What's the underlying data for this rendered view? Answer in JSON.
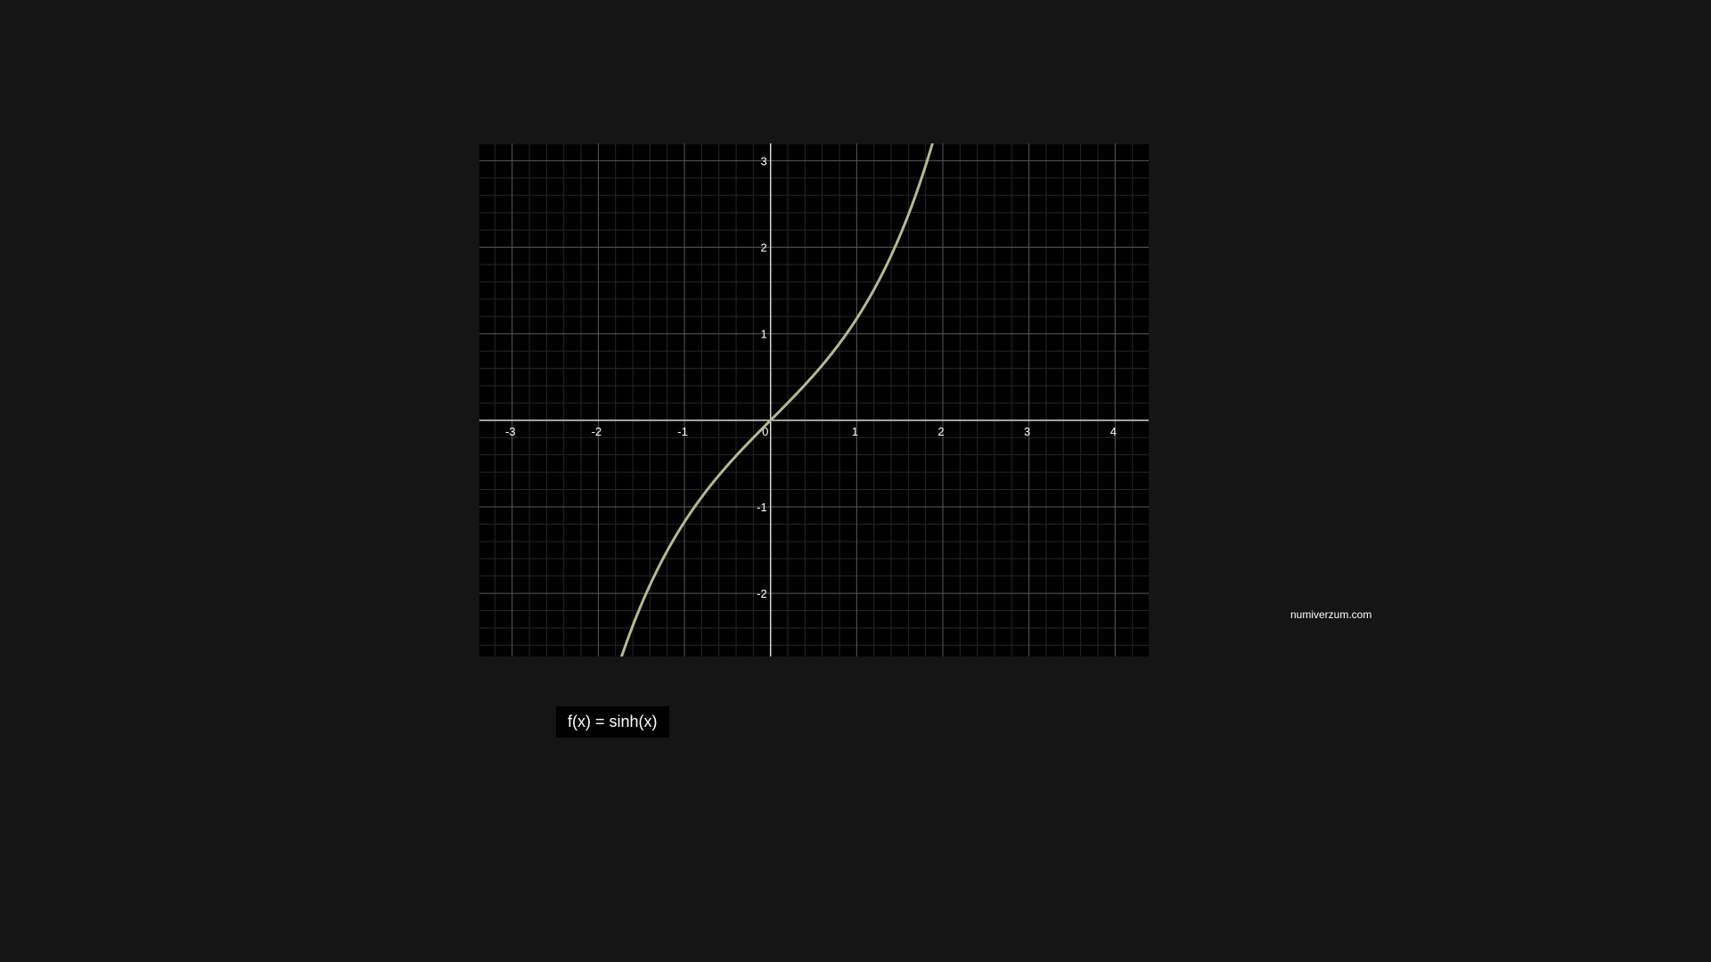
{
  "watermark": "numiverzum.com",
  "function_label": "f(x) = sinh(x)",
  "colors": {
    "page_background": "#151515",
    "plot_background": "#000000",
    "curve": "#b8b98a",
    "axis": "#d8d8d8",
    "major_grid": "#5a5a5a",
    "minor_grid": "#262626",
    "text": "#ffffff"
  },
  "chart_data": {
    "type": "line",
    "function": "sinh",
    "xlim": [
      -3.38,
      4.39
    ],
    "ylim": [
      -2.73,
      3.2
    ],
    "x_ticks": [
      -3,
      -2,
      -1,
      0,
      1,
      2,
      3,
      4
    ],
    "x_tick_labels": [
      "-3",
      "-2",
      "-1",
      "0",
      "1",
      "2",
      "3",
      "4"
    ],
    "y_ticks": [
      -2,
      -1,
      1,
      2,
      3
    ],
    "y_tick_labels": [
      "-2",
      "-1",
      "1",
      "2",
      "3"
    ],
    "minor_divisions": 5,
    "grid": true,
    "series": [
      {
        "name": "f(x) = sinh(x)",
        "x": [
          -1.73,
          -1.5,
          -1.25,
          -1.0,
          -0.75,
          -0.5,
          -0.25,
          0.0,
          0.25,
          0.5,
          0.75,
          1.0,
          1.25,
          1.5,
          1.75,
          1.87
        ],
        "y": [
          -2.73,
          -2.13,
          -1.6,
          -1.18,
          -0.82,
          -0.52,
          -0.25,
          0.0,
          0.25,
          0.52,
          0.82,
          1.18,
          1.6,
          2.13,
          2.79,
          3.2
        ]
      }
    ]
  }
}
